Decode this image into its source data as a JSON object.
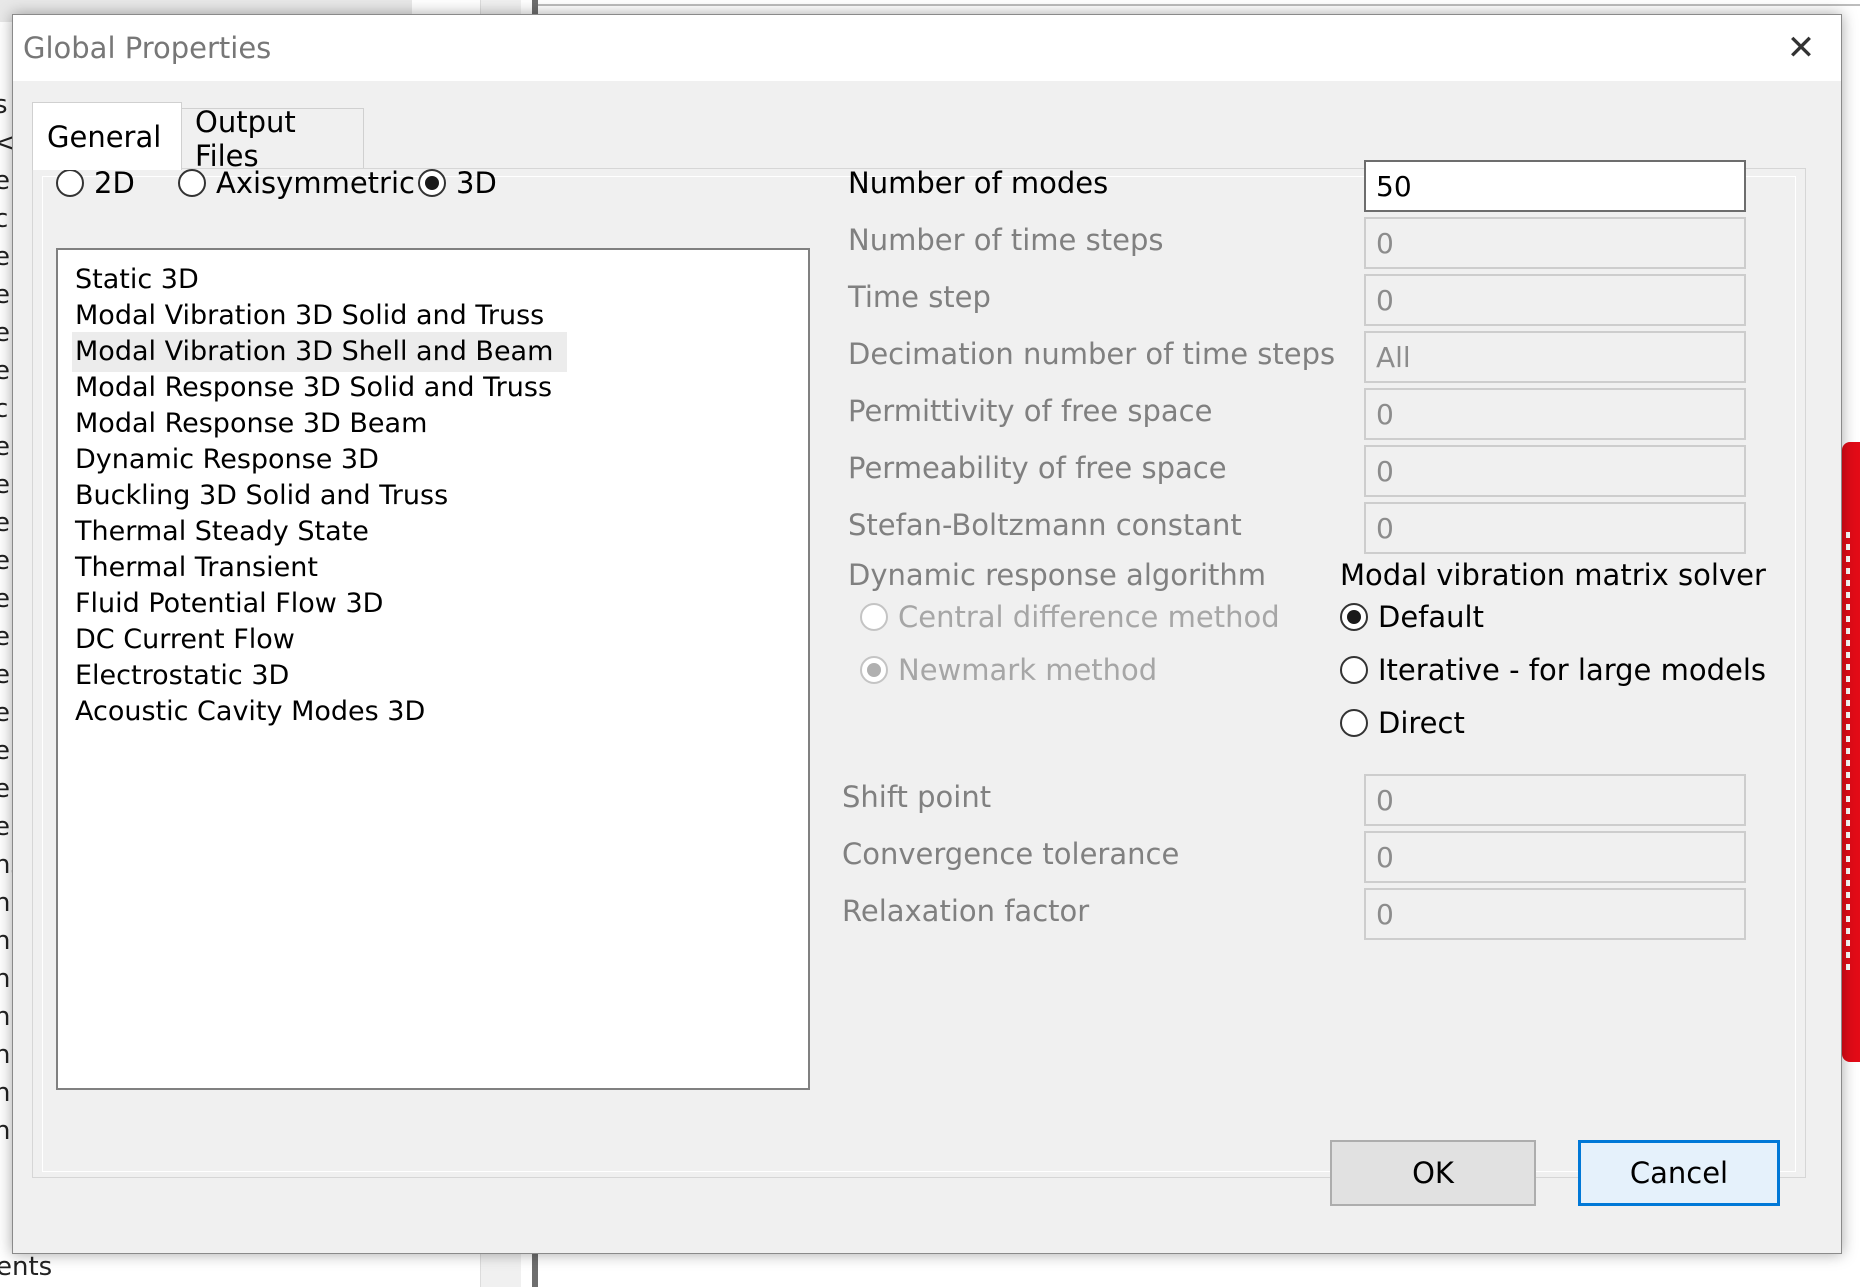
{
  "background": {
    "left_edge_chars": [
      "s",
      "<",
      "e",
      "c",
      "e",
      "e",
      "e",
      "e",
      "c",
      "e",
      "e",
      "e",
      "e",
      "e",
      "e",
      "e",
      "e",
      "e",
      "e",
      "e",
      "ns",
      "n",
      "n",
      "n",
      "n",
      "n",
      "n",
      "n"
    ],
    "bottom_text": "ents"
  },
  "dialog": {
    "title": "Global Properties",
    "close_glyph": "✕"
  },
  "tabs": [
    {
      "label": "General",
      "active": true
    },
    {
      "label": "Output Files",
      "active": false
    }
  ],
  "dimension": {
    "options": [
      {
        "label": "2D",
        "checked": false
      },
      {
        "label": "Axisymmetric",
        "checked": false
      },
      {
        "label": "3D",
        "checked": true
      }
    ]
  },
  "analysis_list": {
    "items": [
      "Static 3D",
      "Modal Vibration 3D Solid and Truss",
      "Modal Vibration 3D Shell and Beam",
      "Modal Response 3D Solid and Truss",
      "Modal Response 3D Beam",
      "Dynamic Response 3D",
      "Buckling 3D Solid and Truss",
      "Thermal Steady State",
      "Thermal Transient",
      "Fluid Potential Flow 3D",
      "DC Current Flow",
      "Electrostatic 3D",
      "Acoustic Cavity Modes 3D"
    ],
    "selected_index": 2
  },
  "properties": [
    {
      "label": "Number of modes",
      "value": "50",
      "enabled": true
    },
    {
      "label": "Number of time steps",
      "value": "0",
      "enabled": false
    },
    {
      "label": "Time step",
      "value": "0",
      "enabled": false
    },
    {
      "label": "Decimation number of time steps",
      "value": "All",
      "enabled": false
    },
    {
      "label": "Permittivity of free space",
      "value": "0",
      "enabled": false
    },
    {
      "label": "Permeability of free space",
      "value": "0",
      "enabled": false
    },
    {
      "label": "Stefan-Boltzmann constant",
      "value": "0",
      "enabled": false
    }
  ],
  "dynamic_response": {
    "heading": "Dynamic response algorithm",
    "options": [
      {
        "label": "Central difference method",
        "checked": false
      },
      {
        "label": "Newmark method",
        "checked": true
      }
    ]
  },
  "matrix_solver": {
    "heading": "Modal vibration matrix solver",
    "options": [
      {
        "label": "Default",
        "checked": true
      },
      {
        "label": "Iterative - for large models",
        "checked": false
      },
      {
        "label": "Direct",
        "checked": false
      }
    ]
  },
  "solver_properties": [
    {
      "label": "Shift point",
      "value": "0",
      "enabled": false
    },
    {
      "label": "Convergence tolerance",
      "value": "0",
      "enabled": false
    },
    {
      "label": "Relaxation factor",
      "value": "0",
      "enabled": false
    }
  ],
  "buttons": {
    "ok": "OK",
    "cancel": "Cancel"
  },
  "colors": {
    "focus_border": "#0078d7",
    "dialog_bg": "#f0f0f0",
    "disabled_text": "#808080",
    "accent_red": "#e30b17"
  }
}
